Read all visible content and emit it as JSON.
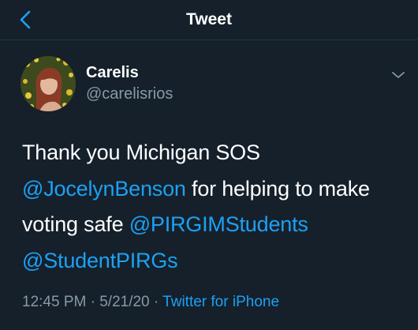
{
  "nav": {
    "title": "Tweet"
  },
  "author": {
    "display_name": "Carelis",
    "handle": "@carelisrios"
  },
  "tweet": {
    "line1": "Thank you Michigan SOS",
    "mention1": "@JocelynBenson",
    "text2": " for helping to make",
    "text3": "voting safe ",
    "mention2": "@PIRGIMStudents",
    "mention3": "@StudentPIRGs"
  },
  "meta": {
    "time": "12:45 PM",
    "sep1": " · ",
    "date": "5/21/20",
    "sep2": " · ",
    "source": "Twitter for iPhone"
  },
  "colors": {
    "background": "#15202b",
    "accent": "#1da1f2",
    "secondary_text": "#8899a6"
  }
}
